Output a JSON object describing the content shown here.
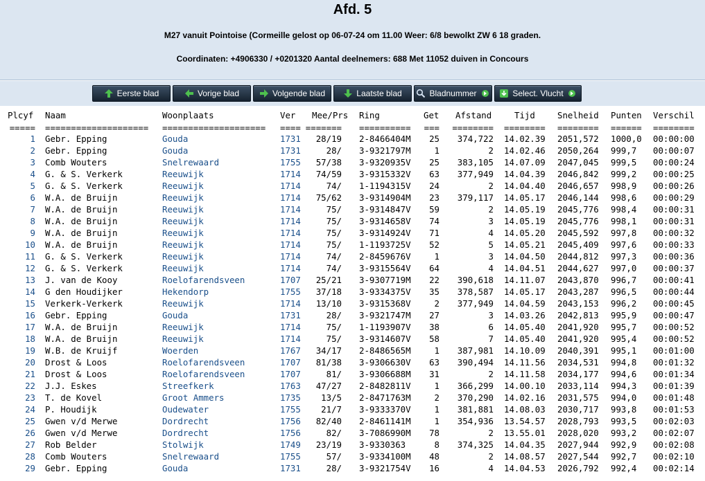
{
  "header": {
    "title": "Afd. 5",
    "line1": "M27 vanuit Pointoise (Cormeille gelost op 06-07-24 om 11.00 Weer: 6/8 bewolkt ZW 6 18 graden.",
    "line2": "Coordinaten: +4906330 / +0201320 Aantal deelnemers: 688 Met 11052 duiven in Concours"
  },
  "nav": {
    "first": "Eerste blad",
    "prev": "Vorige blad",
    "next": "Volgende blad",
    "last": "Laatste blad",
    "page": "Bladnummer",
    "select": "Select. Vlucht"
  },
  "columns": [
    "Plcyf",
    "Naam",
    "Woonplaats",
    "Ver",
    "Mee/Prs",
    "Ring",
    "Get",
    "Afstand",
    "Tijd",
    "Snelheid",
    "Punten",
    "Verschil"
  ],
  "separators": [
    "=====",
    "====================",
    "====================",
    "====",
    "=======",
    "==========",
    "===",
    "========",
    "========",
    "========",
    "======",
    "========"
  ],
  "rows": [
    [
      "1",
      "Gebr. Epping",
      "Gouda",
      "1731",
      "28/19",
      "2-8466404M",
      "25",
      "374,722",
      "14.02.39",
      "2051,572",
      "1000,0",
      "00:00:00"
    ],
    [
      "2",
      "Gebr. Epping",
      "Gouda",
      "1731",
      "28/",
      "3-9321797M",
      "1",
      "2",
      "14.02.46",
      "2050,264",
      "999,7",
      "00:00:07"
    ],
    [
      "3",
      "Comb Wouters",
      "Snelrewaard",
      "1755",
      "57/38",
      "3-9320935V",
      "25",
      "383,105",
      "14.07.09",
      "2047,045",
      "999,5",
      "00:00:24"
    ],
    [
      "4",
      "G. & S. Verkerk",
      "Reeuwijk",
      "1714",
      "74/59",
      "3-9315332V",
      "63",
      "377,949",
      "14.04.39",
      "2046,842",
      "999,2",
      "00:00:25"
    ],
    [
      "5",
      "G. & S. Verkerk",
      "Reeuwijk",
      "1714",
      "74/",
      "1-1194315V",
      "24",
      "2",
      "14.04.40",
      "2046,657",
      "998,9",
      "00:00:26"
    ],
    [
      "6",
      "W.A. de Bruijn",
      "Reeuwijk",
      "1714",
      "75/62",
      "3-9314904M",
      "23",
      "379,117",
      "14.05.17",
      "2046,144",
      "998,6",
      "00:00:29"
    ],
    [
      "7",
      "W.A. de Bruijn",
      "Reeuwijk",
      "1714",
      "75/",
      "3-9314847V",
      "59",
      "2",
      "14.05.19",
      "2045,776",
      "998,4",
      "00:00:31"
    ],
    [
      "8",
      "W.A. de Bruijn",
      "Reeuwijk",
      "1714",
      "75/",
      "3-9314658V",
      "74",
      "3",
      "14.05.19",
      "2045,776",
      "998,1",
      "00:00:31"
    ],
    [
      "9",
      "W.A. de Bruijn",
      "Reeuwijk",
      "1714",
      "75/",
      "3-9314924V",
      "71",
      "4",
      "14.05.20",
      "2045,592",
      "997,8",
      "00:00:32"
    ],
    [
      "10",
      "W.A. de Bruijn",
      "Reeuwijk",
      "1714",
      "75/",
      "1-1193725V",
      "52",
      "5",
      "14.05.21",
      "2045,409",
      "997,6",
      "00:00:33"
    ],
    [
      "11",
      "G. & S. Verkerk",
      "Reeuwijk",
      "1714",
      "74/",
      "2-8459676V",
      "1",
      "3",
      "14.04.50",
      "2044,812",
      "997,3",
      "00:00:36"
    ],
    [
      "12",
      "G. & S. Verkerk",
      "Reeuwijk",
      "1714",
      "74/",
      "3-9315564V",
      "64",
      "4",
      "14.04.51",
      "2044,627",
      "997,0",
      "00:00:37"
    ],
    [
      "13",
      "J. van de Kooy",
      "Roelofarendsveen",
      "1707",
      "25/21",
      "3-9307719M",
      "22",
      "390,618",
      "14.11.07",
      "2043,870",
      "996,7",
      "00:00:41"
    ],
    [
      "14",
      "G den Houdijker",
      "Hekendorp",
      "1755",
      "37/18",
      "3-9334375V",
      "35",
      "378,587",
      "14.05.17",
      "2043,287",
      "996,5",
      "00:00:44"
    ],
    [
      "15",
      "Verkerk-Verkerk",
      "Reeuwijk",
      "1714",
      "13/10",
      "3-9315368V",
      "2",
      "377,949",
      "14.04.59",
      "2043,153",
      "996,2",
      "00:00:45"
    ],
    [
      "16",
      "Gebr. Epping",
      "Gouda",
      "1731",
      "28/",
      "3-9321747M",
      "27",
      "3",
      "14.03.26",
      "2042,813",
      "995,9",
      "00:00:47"
    ],
    [
      "17",
      "W.A. de Bruijn",
      "Reeuwijk",
      "1714",
      "75/",
      "1-1193907V",
      "38",
      "6",
      "14.05.40",
      "2041,920",
      "995,7",
      "00:00:52"
    ],
    [
      "18",
      "W.A. de Bruijn",
      "Reeuwijk",
      "1714",
      "75/",
      "3-9314607V",
      "58",
      "7",
      "14.05.40",
      "2041,920",
      "995,4",
      "00:00:52"
    ],
    [
      "19",
      "W.B. de Kruijf",
      "Woerden",
      "1767",
      "34/17",
      "2-8486565M",
      "1",
      "387,981",
      "14.10.09",
      "2040,391",
      "995,1",
      "00:01:00"
    ],
    [
      "20",
      "Drost & Loos",
      "Roelofarendsveen",
      "1707",
      "81/38",
      "3-9306630V",
      "63",
      "390,494",
      "14.11.56",
      "2034,531",
      "994,8",
      "00:01:32"
    ],
    [
      "21",
      "Drost & Loos",
      "Roelofarendsveen",
      "1707",
      "81/",
      "3-9306688M",
      "31",
      "2",
      "14.11.58",
      "2034,177",
      "994,6",
      "00:01:34"
    ],
    [
      "22",
      "J.J. Eskes",
      "Streefkerk",
      "1763",
      "47/27",
      "2-8482811V",
      "1",
      "366,299",
      "14.00.10",
      "2033,114",
      "994,3",
      "00:01:39"
    ],
    [
      "23",
      "T. de Kovel",
      "Groot Ammers",
      "1735",
      "13/5",
      "2-8471763M",
      "2",
      "370,290",
      "14.02.16",
      "2031,575",
      "994,0",
      "00:01:48"
    ],
    [
      "24",
      "P. Houdijk",
      "Oudewater",
      "1755",
      "21/7",
      "3-9333370V",
      "1",
      "381,881",
      "14.08.03",
      "2030,717",
      "993,8",
      "00:01:53"
    ],
    [
      "25",
      "Gwen v/d Merwe",
      "Dordrecht",
      "1756",
      "82/40",
      "2-8461141M",
      "1",
      "354,936",
      "13.54.57",
      "2028,793",
      "993,5",
      "00:02:03"
    ],
    [
      "26",
      "Gwen v/d Merwe",
      "Dordrecht",
      "1756",
      "82/",
      "3-7086990M",
      "78",
      "2",
      "13.55.01",
      "2028,020",
      "993,2",
      "00:02:07"
    ],
    [
      "27",
      "Rob Belder",
      "Stolwijk",
      "1749",
      "23/19",
      "3-9330363",
      "8",
      "374,325",
      "14.04.35",
      "2027,944",
      "992,9",
      "00:02:08"
    ],
    [
      "28",
      "Comb Wouters",
      "Snelrewaard",
      "1755",
      "57/",
      "3-9334100M",
      "48",
      "2",
      "14.08.57",
      "2027,544",
      "992,7",
      "00:02:10"
    ],
    [
      "29",
      "Gebr. Epping",
      "Gouda",
      "1731",
      "28/",
      "3-9321754V",
      "16",
      "4",
      "14.04.53",
      "2026,792",
      "992,4",
      "00:02:14"
    ]
  ],
  "colors": {
    "header_bg": "#dce6f1",
    "link": "#1a4f8a",
    "button": "#22303e"
  },
  "icons": [
    "arrow-up-icon",
    "arrow-left-icon",
    "arrow-right-icon",
    "arrow-down-icon",
    "magnifier-icon",
    "select-icon"
  ]
}
